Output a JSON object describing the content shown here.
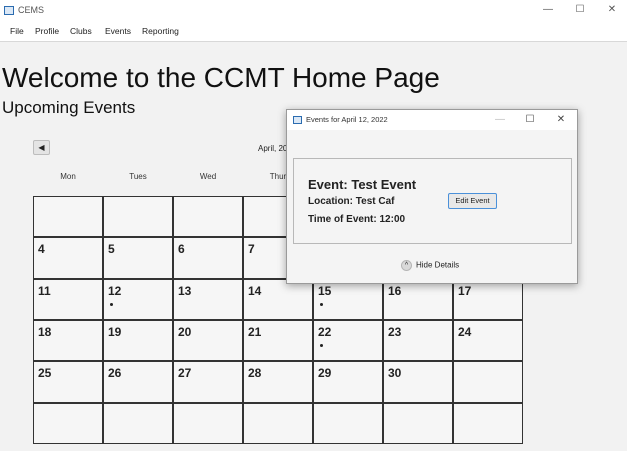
{
  "window": {
    "title": "CEMS",
    "controls": {
      "minimize": "—",
      "maximize": "☐",
      "close": "✕"
    }
  },
  "menu": {
    "items": [
      "File",
      "Profile",
      "Clubs",
      "Events",
      "Reporting"
    ]
  },
  "header": {
    "welcome": "Welcome to the CCMT Home Page",
    "upcoming": "Upcoming Events"
  },
  "calendar": {
    "prev_icon": "◀",
    "month_label": "April, 20",
    "days_of_week": [
      "Mon",
      "Tues",
      "Wed",
      "Thur"
    ],
    "weeks": [
      [
        {
          "day": ""
        },
        {
          "day": ""
        },
        {
          "day": ""
        },
        {
          "day": ""
        },
        {
          "day": ""
        },
        {
          "day": ""
        },
        {
          "day": ""
        }
      ],
      [
        {
          "day": "4"
        },
        {
          "day": "5"
        },
        {
          "day": "6"
        },
        {
          "day": "7"
        },
        {
          "day": ""
        },
        {
          "day": ""
        },
        {
          "day": ""
        }
      ],
      [
        {
          "day": "11"
        },
        {
          "day": "12",
          "event": true
        },
        {
          "day": "13"
        },
        {
          "day": "14"
        },
        {
          "day": "15",
          "event": true
        },
        {
          "day": "16"
        },
        {
          "day": "17"
        }
      ],
      [
        {
          "day": "18"
        },
        {
          "day": "19"
        },
        {
          "day": "20"
        },
        {
          "day": "21"
        },
        {
          "day": "22",
          "event": true
        },
        {
          "day": "23"
        },
        {
          "day": "24"
        }
      ],
      [
        {
          "day": "25"
        },
        {
          "day": "26"
        },
        {
          "day": "27"
        },
        {
          "day": "28"
        },
        {
          "day": "29"
        },
        {
          "day": "30"
        },
        {
          "day": ""
        }
      ],
      [
        {
          "day": ""
        },
        {
          "day": ""
        },
        {
          "day": ""
        },
        {
          "day": ""
        },
        {
          "day": ""
        },
        {
          "day": ""
        },
        {
          "day": ""
        }
      ]
    ]
  },
  "dialog": {
    "title": "Events for April 12, 2022",
    "controls": {
      "minimize": "—",
      "maximize": "☐",
      "close": "✕"
    },
    "event_name": "Event: Test Event",
    "location": "Location: Test Caf",
    "time": "Time of Event: 12:00",
    "edit_button": "Edit Event",
    "hide_details": "Hide Details",
    "hide_icon": "^"
  }
}
